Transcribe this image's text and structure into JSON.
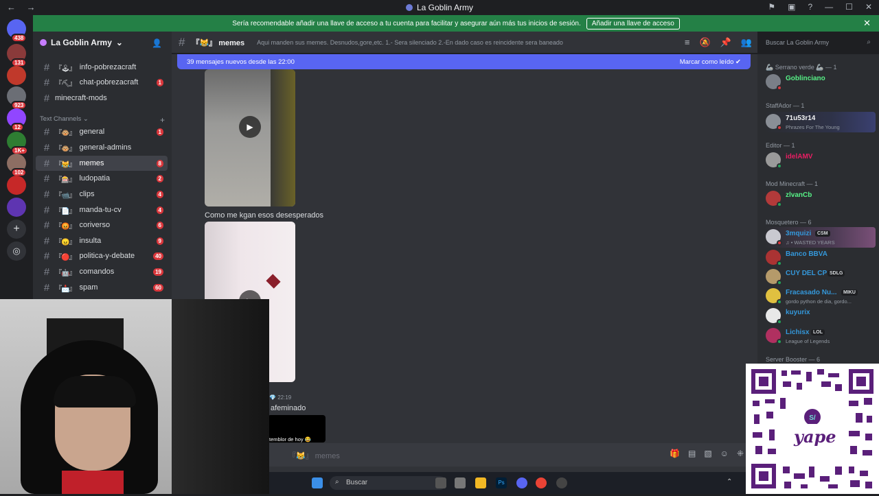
{
  "titlebar": {
    "title": "La Goblin Army",
    "back": "←",
    "forward": "→",
    "min": "—",
    "max": "☐",
    "close": "✕"
  },
  "servers": [
    {
      "badge": "438"
    },
    {
      "badge": "131"
    },
    {
      "badge": ""
    },
    {
      "badge": "923"
    },
    {
      "badge": "12"
    },
    {
      "badge": "1K+"
    },
    {
      "badge": "102"
    },
    {
      "badge": ""
    },
    {
      "badge": ""
    }
  ],
  "notice": {
    "text": "Sería recomendable añadir una llave de acceso a tu cuenta para facilitar y asegurar aún más tus inicios de sesión.",
    "button": "Añadir una llave de acceso",
    "close": "✕"
  },
  "guild": {
    "name": "La Goblin Army",
    "chevron": "⌄"
  },
  "channels_top": [
    {
      "name": "info-pobrezacraft",
      "emoji": "『🕹』",
      "count": ""
    },
    {
      "name": "chat-pobrezacraft",
      "emoji": "『⛏』",
      "count": "1"
    },
    {
      "name": "minecraft-mods",
      "emoji": "",
      "count": ""
    }
  ],
  "category": {
    "label": "Text Channels",
    "chevron": "⌄",
    "plus": "+"
  },
  "channels": [
    {
      "name": "general",
      "emoji": "『🐵』",
      "count": "1"
    },
    {
      "name": "general-admins",
      "emoji": "『🐵』",
      "count": ""
    },
    {
      "name": "memes",
      "emoji": "『😹』",
      "count": "8"
    },
    {
      "name": "ludopatia",
      "emoji": "『🎰』",
      "count": "2"
    },
    {
      "name": "clips",
      "emoji": "『📹』",
      "count": "4"
    },
    {
      "name": "manda-tu-cv",
      "emoji": "『📄』",
      "count": "4"
    },
    {
      "name": "coriverso",
      "emoji": "『😡』",
      "count": "6"
    },
    {
      "name": "insulta",
      "emoji": "『😠』",
      "count": "9"
    },
    {
      "name": "politica-y-debate",
      "emoji": "『🔴』",
      "count": "40"
    },
    {
      "name": "comandos",
      "emoji": "『🤖』",
      "count": "19"
    },
    {
      "name": "spam",
      "emoji": "『📩』",
      "count": "60"
    }
  ],
  "channel_header": {
    "emoji": "『😹』",
    "name": "memes",
    "topic": "Aqui manden sus memes. Desnudos,gore,etc. 1.- Sera silenciado 2.-En dado caso es reincidente sera baneado"
  },
  "search": {
    "placeholder": "Buscar La Goblin Army"
  },
  "new_messages": {
    "text": "39 mensajes nuevos desde las 22:00",
    "action": "Marcar como leído"
  },
  "messages": {
    "caption1": "Como me kgan esos desesperados",
    "time": "22:19",
    "text2": "afeminado",
    "embed_text": "temblor de hoy 😂"
  },
  "composer": {
    "emoji": "『😹』",
    "placeholder": "memes"
  },
  "members": {
    "groups": [
      {
        "label": "🦾 Serrano verde 🦾 — 1",
        "members": [
          {
            "name": "Goblinciano",
            "color": "#57f287",
            "sub": "",
            "tag": ""
          }
        ]
      },
      {
        "label": "StaffAdor — 1",
        "members": [
          {
            "name": "71u53r14",
            "color": "#f2f3f5",
            "sub": "Phrazes For The Young",
            "tag": ""
          }
        ]
      },
      {
        "label": "Editor — 1",
        "members": [
          {
            "name": "idelAMV",
            "color": "#e91e63",
            "sub": "",
            "tag": ""
          }
        ]
      },
      {
        "label": "Mod Minecraft — 1",
        "members": [
          {
            "name": "zlvanCb",
            "color": "#57f287",
            "sub": "",
            "tag": ""
          }
        ]
      },
      {
        "label": "Mosquetero — 6",
        "members": [
          {
            "name": "3mquizi",
            "color": "#3498db",
            "sub": "♫ • WASTED YEARS",
            "tag": "CSM"
          },
          {
            "name": "Banco BBVA",
            "color": "#3498db",
            "sub": "",
            "tag": ""
          },
          {
            "name": "CUY DEL CP",
            "color": "#3498db",
            "sub": "",
            "tag": "SDLG"
          },
          {
            "name": "Fracasado Nu...",
            "color": "#3498db",
            "sub": "gordo python de dia, gordo...",
            "tag": "MIKU"
          },
          {
            "name": "kuyurix",
            "color": "#3498db",
            "sub": "",
            "tag": ""
          },
          {
            "name": "Lichisx",
            "color": "#3498db",
            "sub": "League of Legends",
            "tag": "LOL"
          }
        ]
      },
      {
        "label": "Server Booster — 6",
        "members": []
      }
    ]
  },
  "taskbar": {
    "search": "Buscar"
  },
  "overlay": {
    "qr_brand": "yape"
  }
}
